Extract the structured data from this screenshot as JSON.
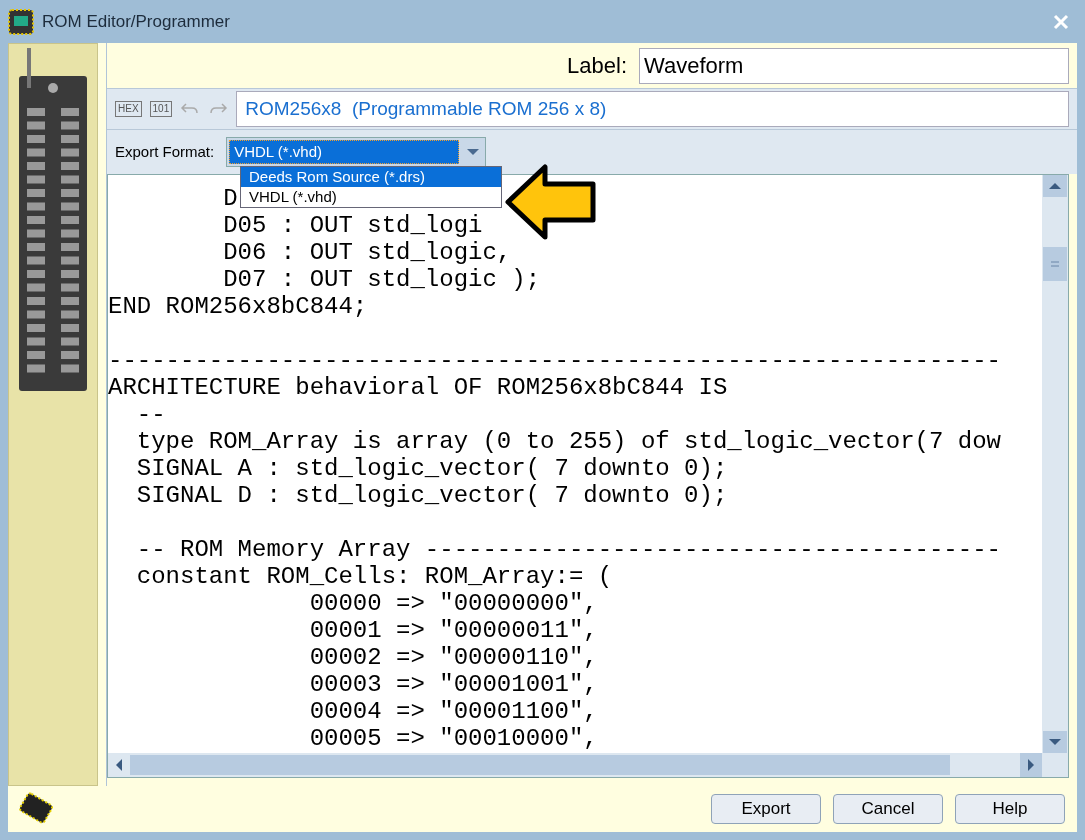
{
  "window": {
    "title": "ROM Editor/Programmer"
  },
  "label_field": {
    "label": "Label:",
    "value": "Waveform"
  },
  "toolbar": {
    "buttons": [
      "HEX",
      "101"
    ],
    "description": "ROM256x8  (Programmable ROM 256 x 8)"
  },
  "export_format": {
    "label": "Export Format:",
    "value": "VHDL (*.vhd)",
    "expanded": true,
    "options": [
      {
        "label": "Deeds Rom Source (*.drs)",
        "highlighted": true
      },
      {
        "label": "VHDL (*.vhd)",
        "highlighted": false
      }
    ]
  },
  "code_lines": [
    {
      "kind": "text",
      "text": "        D"
    },
    {
      "kind": "text",
      "text": "        D05 : OUT std_logi"
    },
    {
      "kind": "text",
      "text": "        D06 : OUT std_logic,"
    },
    {
      "kind": "text",
      "text": "        D07 : OUT std_logic );"
    },
    {
      "kind": "text",
      "text": "END ROM256x8bC844;"
    },
    {
      "kind": "blank"
    },
    {
      "kind": "text",
      "text": "--------------------------------------------------------------"
    },
    {
      "kind": "text",
      "text": "ARCHITECTURE behavioral OF ROM256x8bC844 IS"
    },
    {
      "kind": "text",
      "text": "  --"
    },
    {
      "kind": "text",
      "text": "  type ROM_Array is array (0 to 255) of std_logic_vector(7 dow"
    },
    {
      "kind": "text",
      "text": "  SIGNAL A : std_logic_vector( 7 downto 0);"
    },
    {
      "kind": "text",
      "text": "  SIGNAL D : std_logic_vector( 7 downto 0);"
    },
    {
      "kind": "blank"
    },
    {
      "kind": "text",
      "text": "  -- ROM Memory Array ----------------------------------------"
    },
    {
      "kind": "text",
      "text": "  constant ROM_Cells: ROM_Array:= ("
    },
    {
      "kind": "text",
      "text": "              00000 => \"00000000\","
    },
    {
      "kind": "text",
      "text": "              00001 => \"00000011\","
    },
    {
      "kind": "text",
      "text": "              00002 => \"00000110\","
    },
    {
      "kind": "text",
      "text": "              00003 => \"00001001\","
    },
    {
      "kind": "text",
      "text": "              00004 => \"00001100\","
    },
    {
      "kind": "text",
      "text": "              00005 => \"00010000\","
    }
  ],
  "buttons": [
    "Export",
    "Cancel",
    "Help"
  ]
}
